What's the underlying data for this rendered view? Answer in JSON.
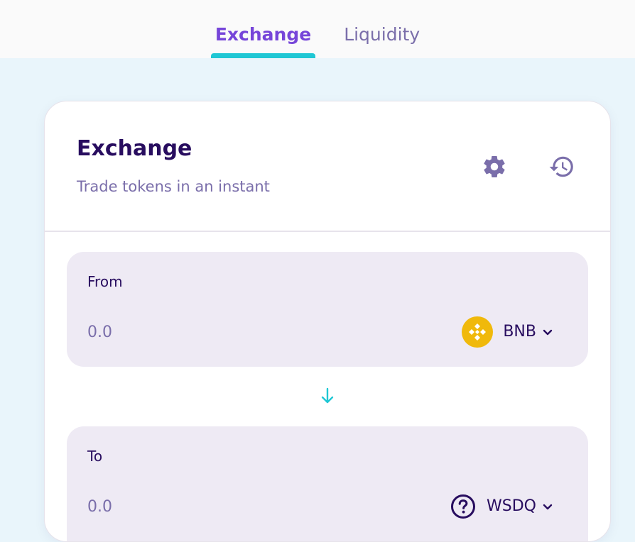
{
  "nav": {
    "tabs": [
      {
        "label": "Exchange",
        "active": true
      },
      {
        "label": "Liquidity",
        "active": false
      }
    ]
  },
  "card": {
    "title": "Exchange",
    "subtitle": "Trade tokens in an instant",
    "icons": {
      "settings": "gear-icon",
      "history": "history-icon"
    }
  },
  "from": {
    "label": "From",
    "placeholder": "0.0",
    "token": "BNB",
    "token_icon": "bnb-logo-icon"
  },
  "swap": {
    "icon": "arrow-down-icon"
  },
  "to": {
    "label": "To",
    "placeholder": "0.0",
    "token": "WSDQ",
    "token_icon": "question-circle-icon"
  },
  "colors": {
    "primary_text": "#280d5f",
    "secondary_text": "#7a6eaa",
    "accent": "#7645d9",
    "cyan": "#1fc7d4",
    "panel_bg": "#eeeaf4",
    "page_bg": "#e9f5fb",
    "bnb_yellow": "#f0b90b"
  }
}
